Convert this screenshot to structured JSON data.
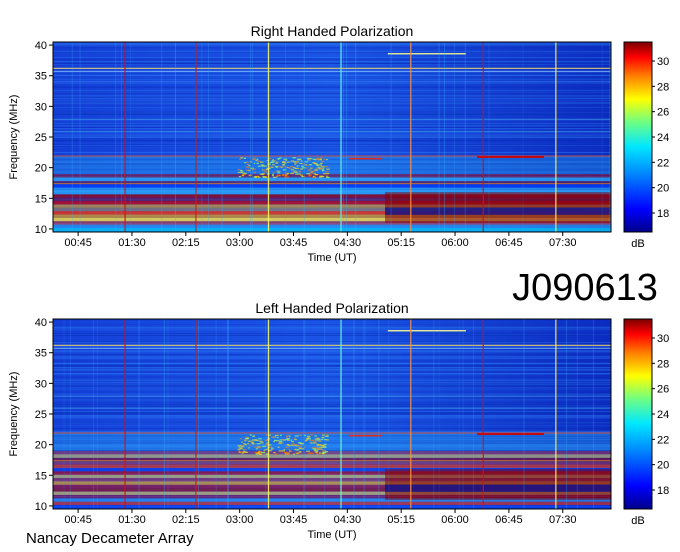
{
  "header": {
    "observation_id": "J090613"
  },
  "footer": {
    "instrument": "Nancay Decameter Array"
  },
  "colors": {
    "spectrum_low": "#0000aa",
    "spectrum_mid": "#2aa0ff",
    "spectrum_high": "#ffd000",
    "spectrum_max": "#900000"
  },
  "chart_data": [
    {
      "type": "heatmap",
      "title": "Right Handed Polarization",
      "xlabel": "Time (UT)",
      "ylabel": "Frequency (MHz)",
      "x_ticks": [
        "00:45",
        "01:30",
        "02:15",
        "03:00",
        "03:45",
        "04:30",
        "05:15",
        "06:00",
        "06:45",
        "07:30"
      ],
      "y_ticks": [
        10,
        15,
        20,
        25,
        30,
        35,
        40
      ],
      "ylim": [
        9.5,
        40.5
      ],
      "colorbar": {
        "label": "dB",
        "ticks": [
          18,
          20,
          22,
          24,
          26,
          28,
          30
        ],
        "range": [
          16.5,
          31.5
        ]
      }
    },
    {
      "type": "heatmap",
      "title": "Left Handed Polarization",
      "xlabel": "Time (UT)",
      "ylabel": "Frequency (MHz)",
      "x_ticks": [
        "00:45",
        "01:30",
        "02:15",
        "03:00",
        "03:45",
        "04:30",
        "05:15",
        "06:00",
        "06:45",
        "07:30"
      ],
      "y_ticks": [
        10,
        15,
        20,
        25,
        30,
        35,
        40
      ],
      "ylim": [
        9.5,
        40.5
      ],
      "colorbar": {
        "label": "dB",
        "ticks": [
          18,
          20,
          22,
          24,
          26,
          28,
          30
        ],
        "range": [
          16.5,
          31.5
        ]
      }
    }
  ]
}
